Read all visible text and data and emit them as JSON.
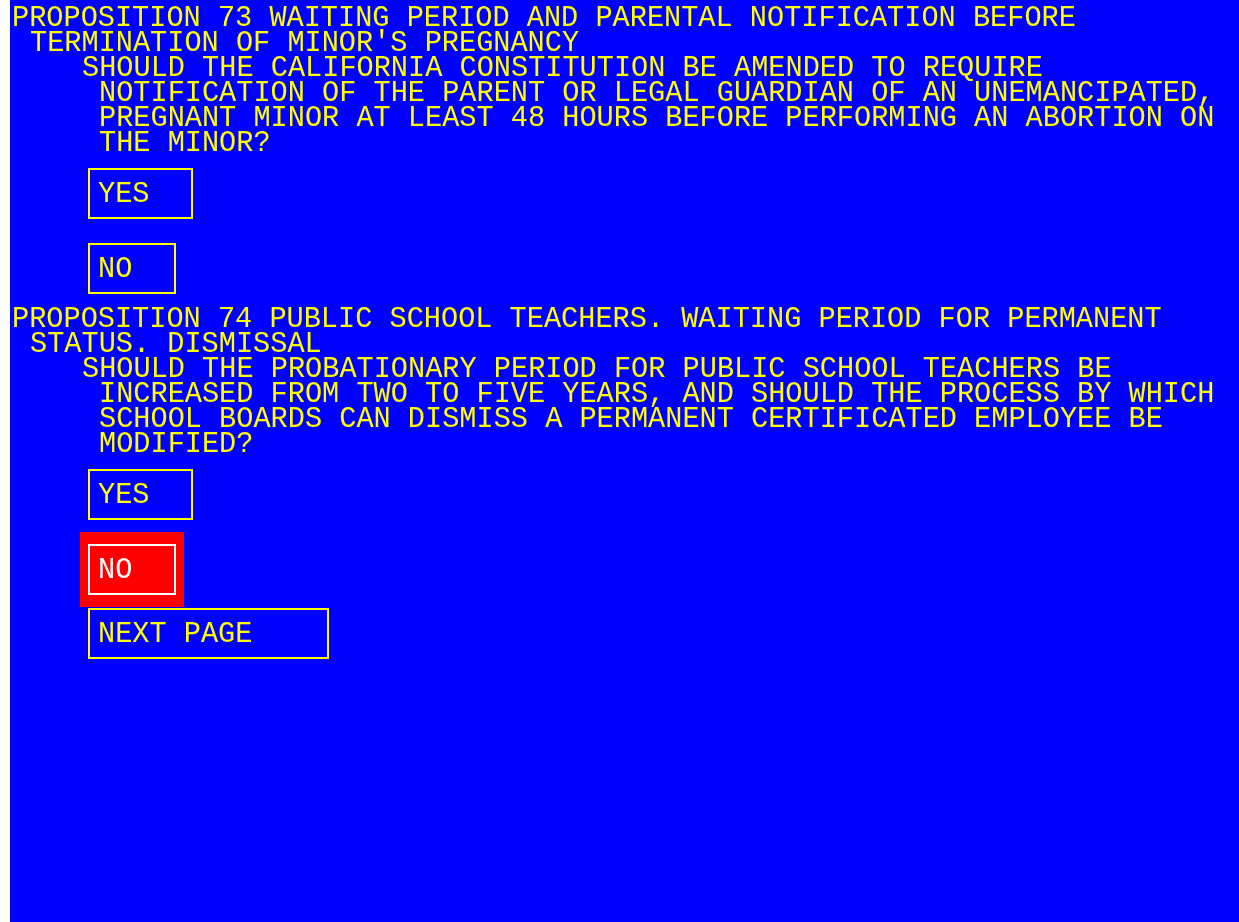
{
  "propositions": [
    {
      "title": "PROPOSITION 73 WAITING PERIOD AND PARENTAL NOTIFICATION BEFORE TERMINATION OF MINOR'S PREGNANCY",
      "question": "SHOULD THE CALIFORNIA CONSTITUTION BE AMENDED TO REQUIRE NOTIFICATION OF THE PARENT OR LEGAL GUARDIAN OF AN UNEMANCIPATED, PREGNANT MINOR AT LEAST 48 HOURS BEFORE PERFORMING AN ABORTION ON THE MINOR?",
      "options": [
        {
          "label": "YES",
          "selected": false
        },
        {
          "label": "NO",
          "selected": false
        }
      ]
    },
    {
      "title": "PROPOSITION 74 PUBLIC SCHOOL TEACHERS. WAITING PERIOD FOR PERMANENT STATUS. DISMISSAL",
      "question": "SHOULD THE PROBATIONARY PERIOD FOR PUBLIC SCHOOL TEACHERS BE INCREASED FROM TWO TO FIVE YEARS, AND SHOULD THE PROCESS BY WHICH SCHOOL BOARDS CAN DISMISS A PERMANENT CERTIFICATED EMPLOYEE BE MODIFIED?",
      "options": [
        {
          "label": "YES",
          "selected": false
        },
        {
          "label": "NO",
          "selected": true
        }
      ]
    }
  ],
  "next_button": "NEXT PAGE"
}
